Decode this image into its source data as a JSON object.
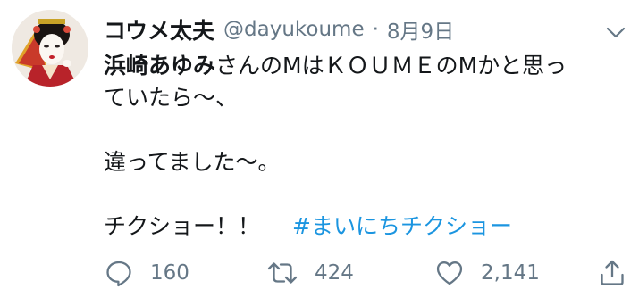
{
  "tweet": {
    "display_name": "コウメ太夫",
    "handle": "@dayukoume",
    "separator": "·",
    "date": "8月9日",
    "text": {
      "line1_bold": "浜崎あゆみ",
      "line1_rest": "さんのMはＫＯＵＭＥのMかと思っ",
      "line2": "ていたら〜、",
      "line3": "違ってました〜。",
      "line4": "チクショー！！",
      "hashtag": "#まいにちチクショー"
    },
    "actions": {
      "reply_count": "160",
      "retweet_count": "424",
      "like_count": "2,141"
    }
  },
  "colors": {
    "text": "#14171a",
    "secondary": "#657786",
    "link": "#1b95e0"
  },
  "icons": [
    "avatar-photo",
    "chevron-down-icon",
    "reply-icon",
    "retweet-icon",
    "like-icon",
    "share-icon"
  ]
}
